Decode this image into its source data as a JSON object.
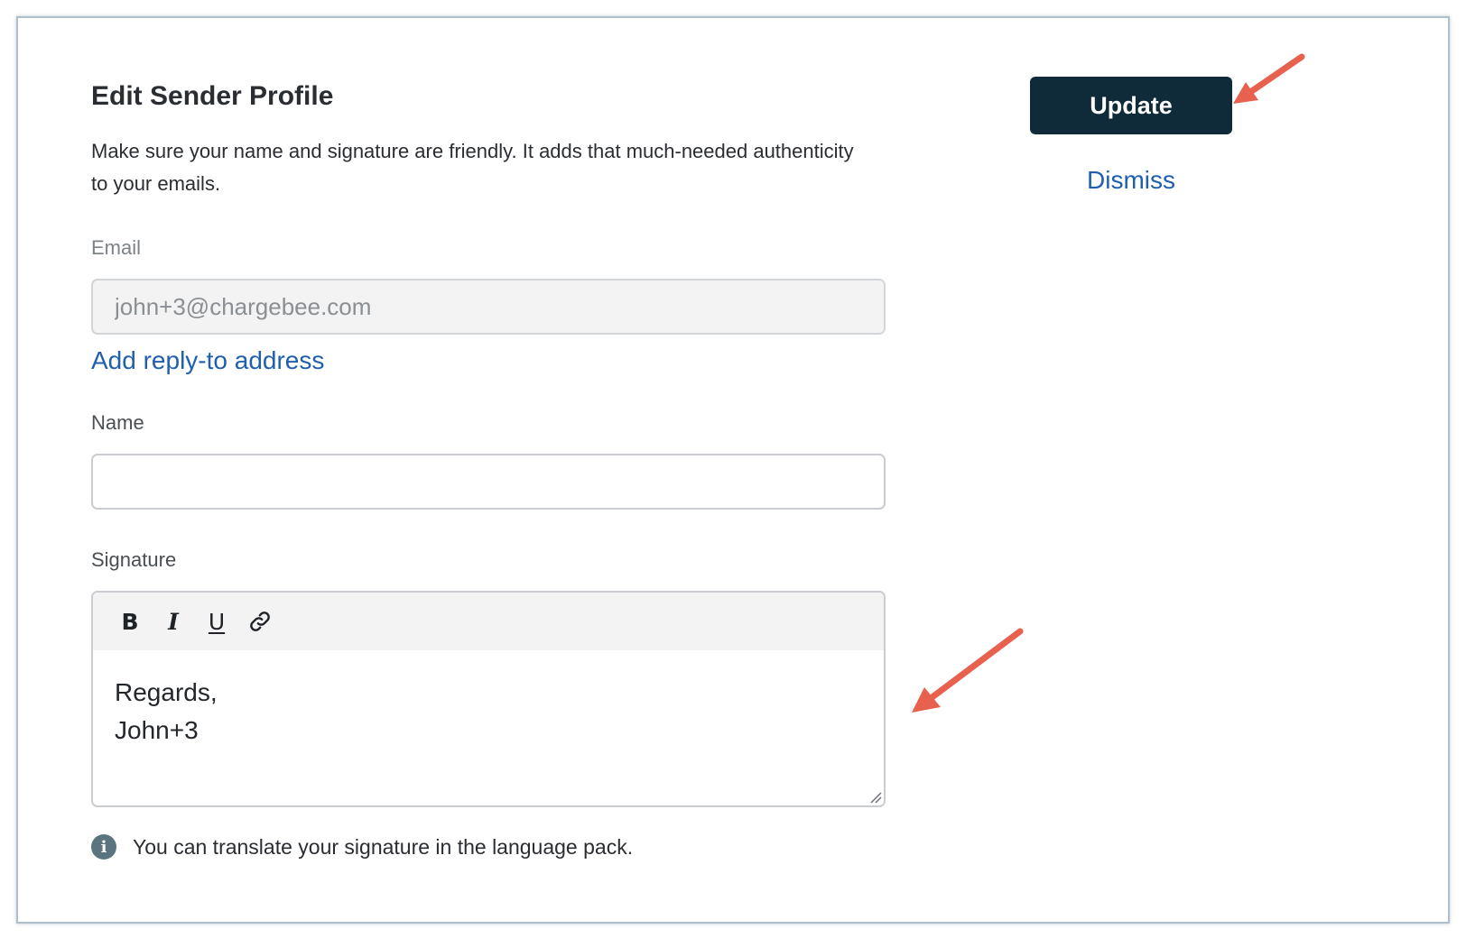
{
  "dialog": {
    "title": "Edit Sender Profile",
    "description": "Make sure your name and signature are friendly. It adds that much-needed authenticity to your emails."
  },
  "actions": {
    "update_label": "Update",
    "dismiss_label": "Dismiss"
  },
  "email": {
    "label": "Email",
    "value": "john+3@chargebee.com",
    "add_reply_to_label": "Add reply-to address"
  },
  "name": {
    "label": "Name",
    "value": ""
  },
  "signature": {
    "label": "Signature",
    "toolbar": {
      "bold": "B",
      "italic": "I",
      "underline": "U"
    },
    "lines": [
      "Regards,",
      "John+3"
    ],
    "info_text": "You can translate your signature in the language pack."
  },
  "icons": {
    "info": "info-icon",
    "link": "link-icon",
    "annotation": "arrow-icon"
  },
  "colors": {
    "primary_button": "#0f2a38",
    "link": "#1f5fae",
    "annotation_arrow": "#e8604e",
    "info_icon": "#5b7580"
  }
}
